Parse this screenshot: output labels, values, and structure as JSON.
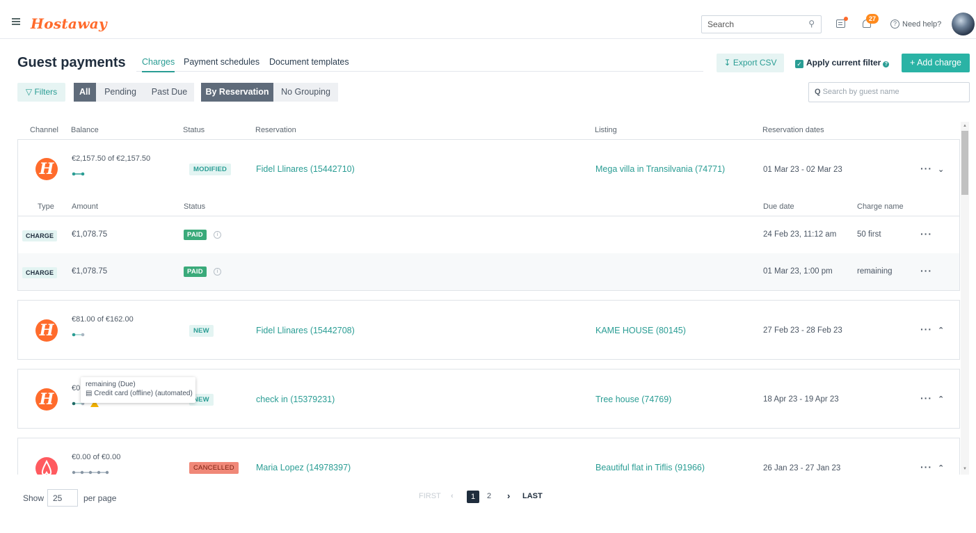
{
  "app": {
    "name": "Hostaway"
  },
  "topbar": {
    "search_placeholder": "Search",
    "notifications_count": "27",
    "help_label": "Need help?"
  },
  "page": {
    "title": "Guest payments"
  },
  "tabs": [
    {
      "label": "Charges",
      "active": true
    },
    {
      "label": "Payment schedules",
      "active": false
    },
    {
      "label": "Document templates",
      "active": false
    }
  ],
  "actions": {
    "export_label": "Export CSV",
    "apply_filter_label": "Apply current filter",
    "apply_filter_checked": true,
    "add_charge_label": "Add charge"
  },
  "filters": {
    "filters_label": "Filters",
    "status_segments": [
      {
        "label": "All",
        "selected": true
      },
      {
        "label": "Pending",
        "selected": false
      },
      {
        "label": "Past Due",
        "selected": false
      }
    ],
    "grouping_segments": [
      {
        "label": "By Reservation",
        "selected": true
      },
      {
        "label": "No Grouping",
        "selected": false
      }
    ],
    "guest_search_placeholder": "Search by guest name"
  },
  "table": {
    "columns": [
      "Channel",
      "Balance",
      "Status",
      "Reservation",
      "Listing",
      "Reservation dates"
    ],
    "sub_columns": [
      "Type",
      "Amount",
      "Status",
      "Due date",
      "Charge name"
    ],
    "reservations": [
      {
        "channel": "hostaway",
        "balance": "€2,157.50 of €2,157.50",
        "status": "MODIFIED",
        "reservation": "Fidel Llinares (15442710)",
        "listing": "Mega villa in Transilvania (74771)",
        "dates": "01 Mar 23 - 02 Mar 23",
        "expanded": true,
        "charges": [
          {
            "type": "CHARGE",
            "amount": "€1,078.75",
            "status": "PAID",
            "due": "24 Feb 23, 11:12 am",
            "name": "50 first"
          },
          {
            "type": "CHARGE",
            "amount": "€1,078.75",
            "status": "PAID",
            "due": "01 Mar 23, 1:00 pm",
            "name": "remaining"
          }
        ]
      },
      {
        "channel": "hostaway",
        "balance": "€81.00 of €162.00",
        "status": "NEW",
        "reservation": "Fidel Llinares (15442708)",
        "listing": "KAME HOUSE (80145)",
        "dates": "27 Feb 23 - 28 Feb 23",
        "expanded": false
      },
      {
        "channel": "hostaway",
        "balance": "€0",
        "status": "NEW",
        "reservation": "check in (15379231)",
        "listing": "Tree house (74769)",
        "dates": "18 Apr 23 - 19 Apr 23",
        "expanded": false
      },
      {
        "channel": "airbnb",
        "balance": "€0.00 of €0.00",
        "status": "CANCELLED",
        "reservation": "Maria Lopez (14978397)",
        "listing": "Beautiful flat in Tiflis (91966)",
        "dates": "26 Jan 23 - 27 Jan 23",
        "expanded": false
      }
    ]
  },
  "tooltip": {
    "line1": "remaining  (Due)",
    "line2": "Credit card (offline) (automated)"
  },
  "pagination": {
    "show_label": "Show",
    "per_page_value": "25",
    "per_page_label": "per page",
    "first_label": "FIRST",
    "last_label": "LAST",
    "pages": [
      "1",
      "2"
    ],
    "current_page": "1"
  },
  "colors": {
    "brand": "#ff6a2b",
    "accent": "#2a9d94",
    "add_button": "#2ab3a5",
    "paid": "#3aaa7a",
    "cancelled": "#f08878"
  }
}
